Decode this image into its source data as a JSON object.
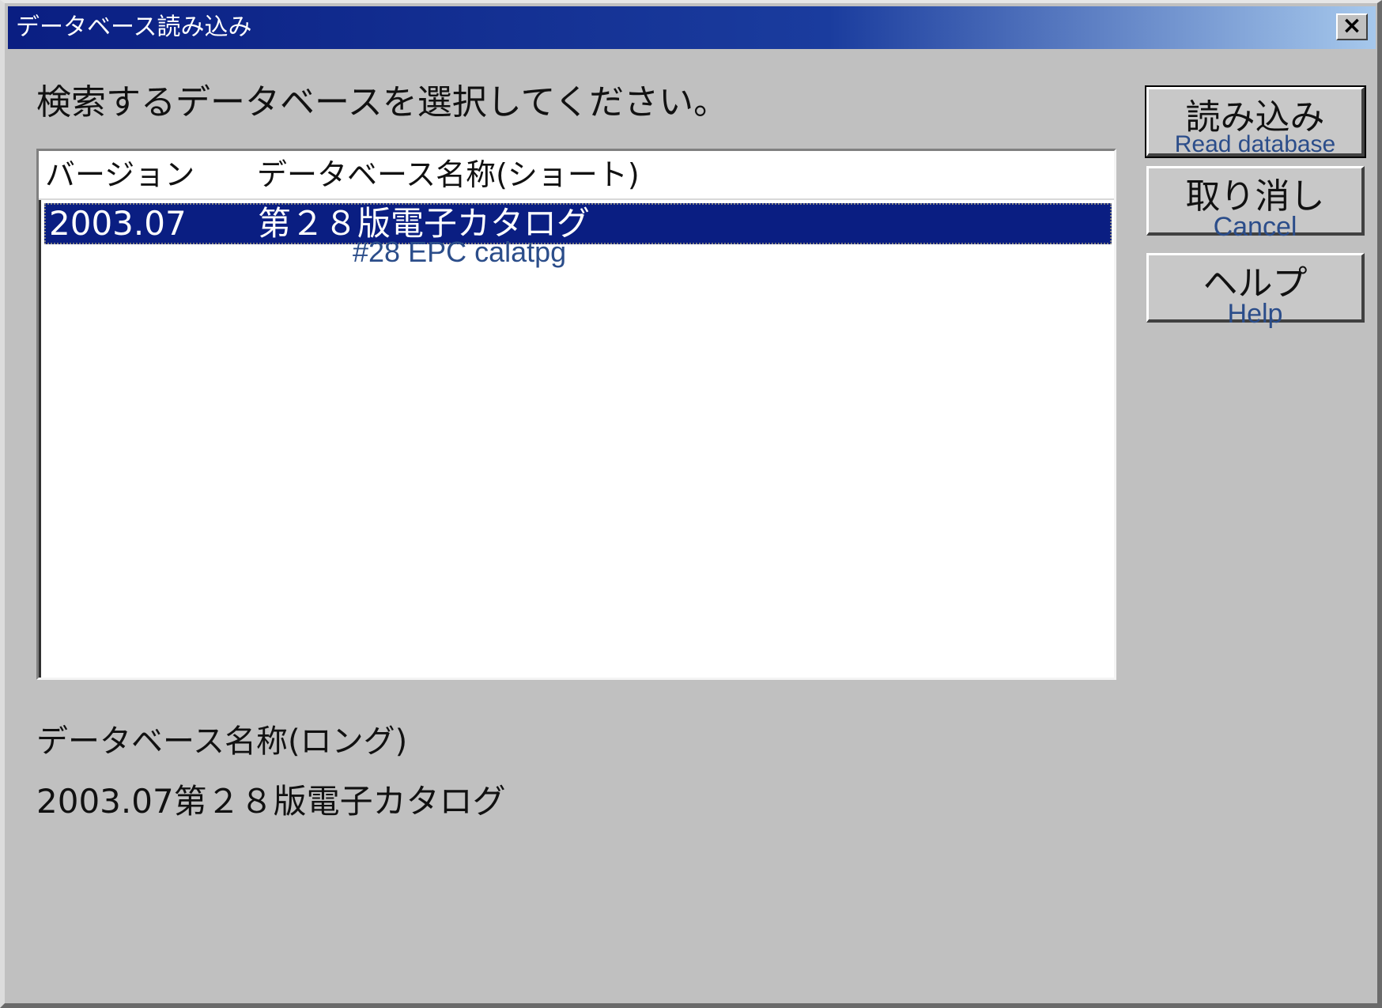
{
  "window": {
    "title": "データベース読み込み",
    "close_glyph": "×"
  },
  "prompt": "検索するデータベースを選択してください。",
  "list": {
    "columns": [
      "バージョン",
      "データベース名称(ショート)"
    ],
    "rows": [
      {
        "version": "2003.07",
        "short_name": "第２８版電子カタログ",
        "selected": true
      }
    ]
  },
  "annotations": {
    "row_caption": "#28 EPC calatpg"
  },
  "buttons": {
    "read": {
      "label": "読み込み",
      "caption": "Read database"
    },
    "cancel": {
      "label": "取り消し",
      "caption": "Cancel"
    },
    "help": {
      "label": "ヘルプ",
      "caption": "Help"
    }
  },
  "long_name": {
    "label": "データベース名称(ロング)",
    "value": "2003.07第２８版電子カタログ"
  },
  "colors": {
    "selection": "#0a1e82",
    "caption": "#2b4d8a",
    "dialog_bg": "#c0c0c0"
  }
}
